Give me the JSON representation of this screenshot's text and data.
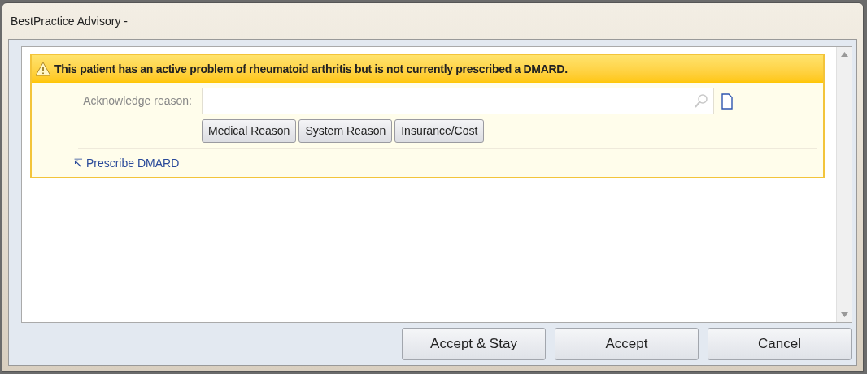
{
  "window": {
    "title": "BestPractice Advisory -"
  },
  "advisory": {
    "message": "This patient has an active problem of rheumatoid arthritis but is not currently prescribed a DMARD.",
    "reason_label": "Acknowledge reason:",
    "reason_buttons": [
      "Medical Reason",
      "System Reason",
      "Insurance/Cost"
    ],
    "link_arrow": "↸",
    "link": "Prescribe DMARD"
  },
  "buttons": [
    "Accept & Stay",
    "Accept",
    "Cancel"
  ]
}
